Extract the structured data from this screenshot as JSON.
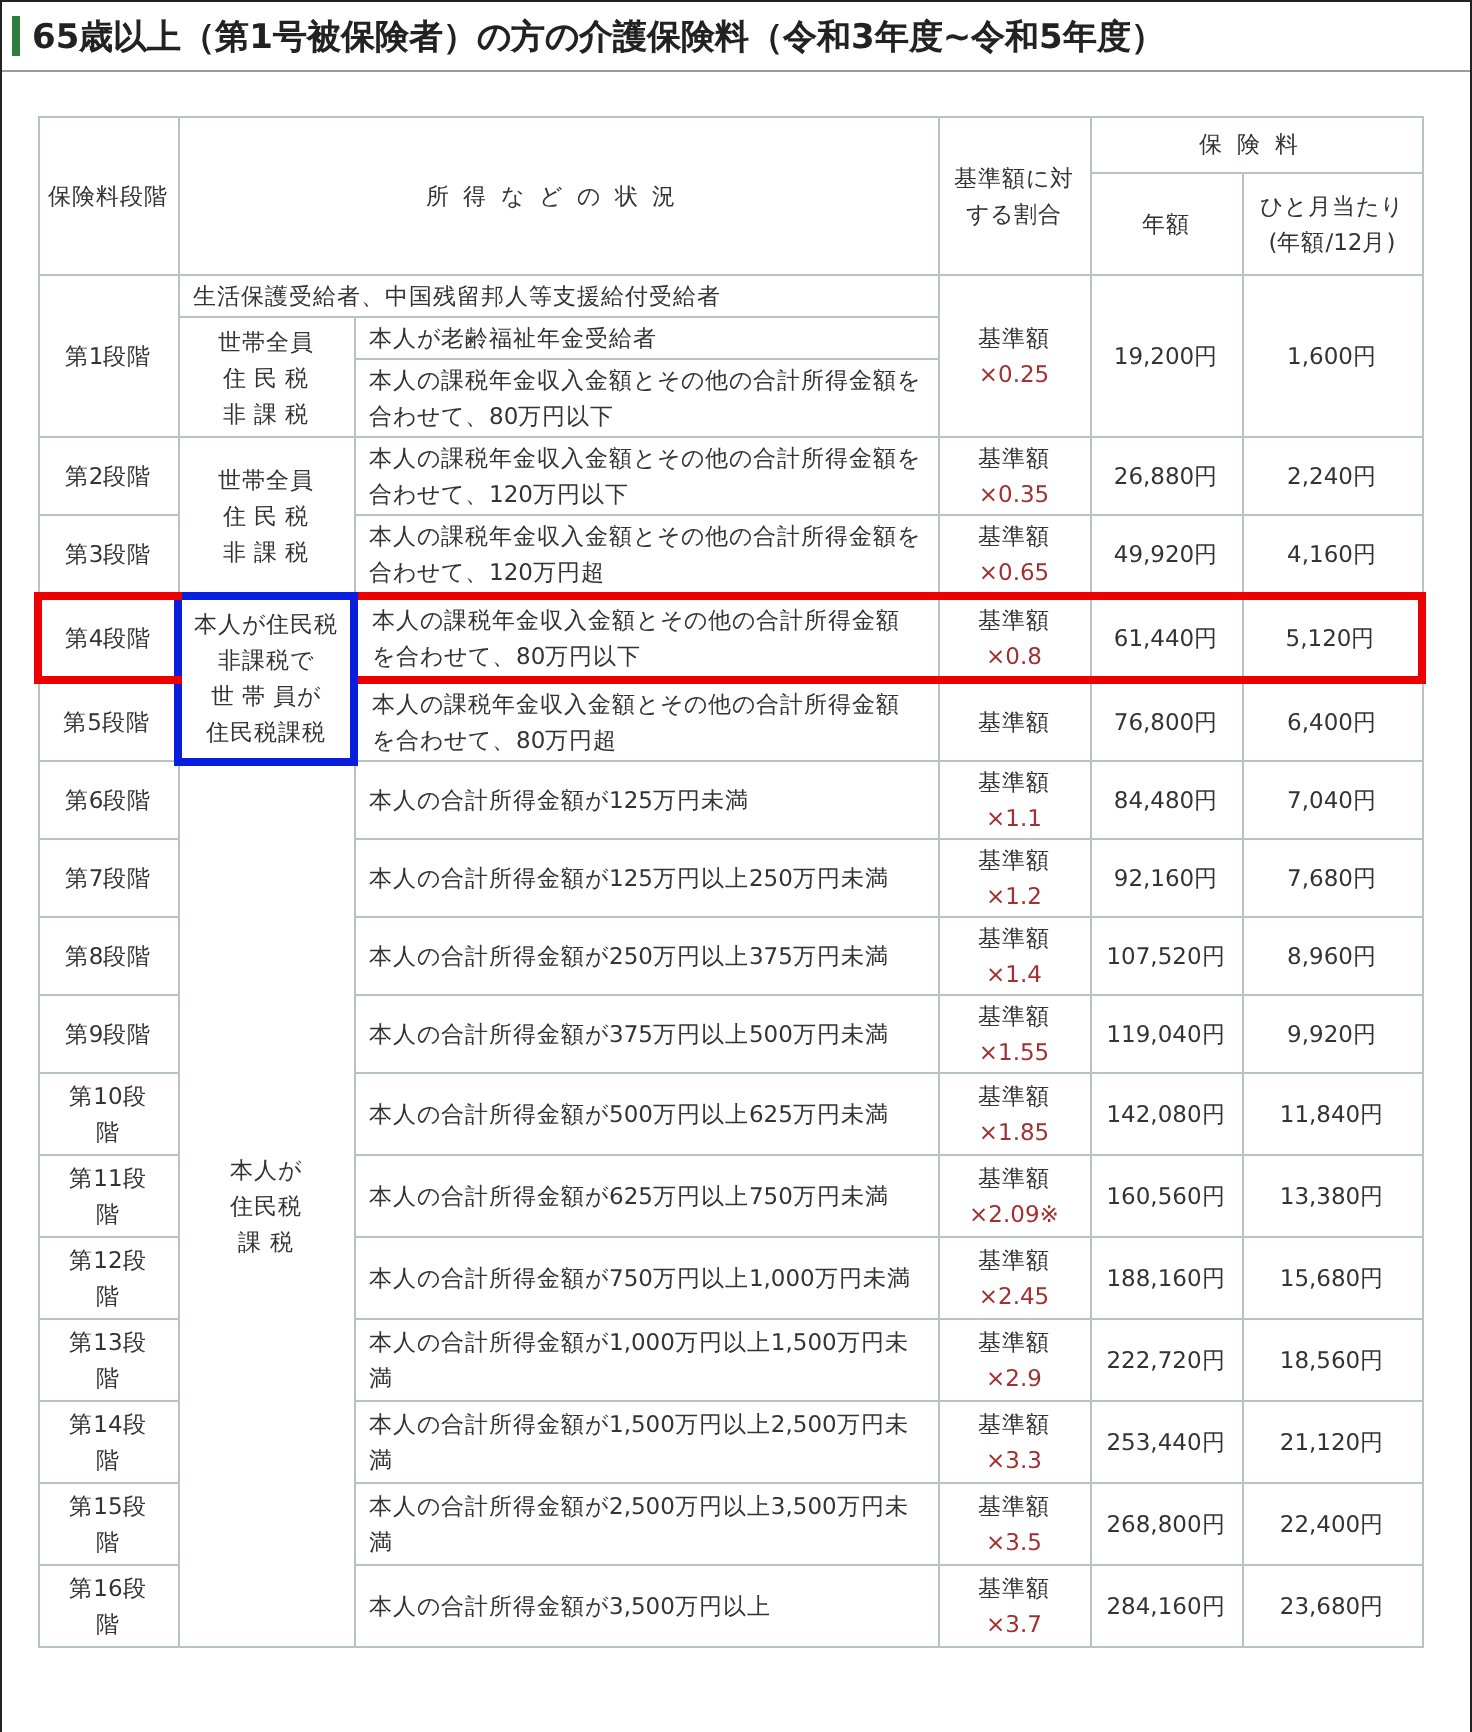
{
  "title": "65歳以上（第1号被保険者）の方の介護保険料（令和3年度~令和5年度）",
  "table": {
    "headers": {
      "stage": "保険料段階",
      "situation": "所得などの状況",
      "ratio": "基準額に対する割合",
      "premium": "保険料",
      "annual": "年額",
      "monthly": "ひと月当たり(年額/12月)"
    },
    "groups": [
      {
        "lines": [
          "世帯全員",
          "住 民 税",
          "非 課 税"
        ],
        "highlighted": false,
        "stages": [
          {
            "label": "第1段階",
            "highlighted": false,
            "general_condition": "生活保護受給者、中国残留邦人等支援給付受給者",
            "conditions": [
              "本人が老齢福祉年金受給者",
              "本人の課税年金収入金額とその他の合計所得金額を合わせて、80万円以下"
            ],
            "ratio": "基準額",
            "multiplier": "×0.25",
            "annual": "19,200円",
            "monthly": "1,600円"
          }
        ]
      },
      {
        "lines": [
          "世帯全員",
          "住 民 税",
          "非 課 税"
        ],
        "highlighted": false,
        "stages": [
          {
            "label": "第2段階",
            "highlighted": false,
            "conditions": [
              "本人の課税年金収入金額とその他の合計所得金額を合わせて、120万円以下"
            ],
            "ratio": "基準額",
            "multiplier": "×0.35",
            "annual": "26,880円",
            "monthly": "2,240円"
          },
          {
            "label": "第3段階",
            "highlighted": false,
            "conditions": [
              "本人の課税年金収入金額とその他の合計所得金額を合わせて、120万円超"
            ],
            "ratio": "基準額",
            "multiplier": "×0.65",
            "annual": "49,920円",
            "monthly": "4,160円"
          }
        ]
      },
      {
        "lines": [
          "本人が住民税",
          "非課税で",
          "世 帯 員が",
          "住民税課税"
        ],
        "highlighted": true,
        "stages": [
          {
            "label": "第4段階",
            "highlighted": true,
            "conditions": [
              "本人の課税年金収入金額とその他の合計所得金額を合わせて、80万円以下"
            ],
            "ratio": "基準額",
            "multiplier": "×0.8",
            "annual": "61,440円",
            "monthly": "5,120円"
          },
          {
            "label": "第5段階",
            "highlighted": false,
            "conditions": [
              "本人の課税年金収入金額とその他の合計所得金額を合わせて、80万円超"
            ],
            "ratio": "基準額",
            "annual": "76,800円",
            "monthly": "6,400円"
          }
        ]
      },
      {
        "lines": [
          "本人が",
          "住民税",
          "課 税"
        ],
        "highlighted": false,
        "stages": [
          {
            "label": "第6段階",
            "highlighted": false,
            "conditions": [
              "本人の合計所得金額が125万円未満"
            ],
            "ratio": "基準額",
            "multiplier": "×1.1",
            "annual": "84,480円",
            "monthly": "7,040円"
          },
          {
            "label": "第7段階",
            "highlighted": false,
            "conditions": [
              "本人の合計所得金額が125万円以上250万円未満"
            ],
            "ratio": "基準額",
            "multiplier": "×1.2",
            "annual": "92,160円",
            "monthly": "7,680円"
          },
          {
            "label": "第8段階",
            "highlighted": false,
            "conditions": [
              "本人の合計所得金額が250万円以上375万円未満"
            ],
            "ratio": "基準額",
            "multiplier": "×1.4",
            "annual": "107,520円",
            "monthly": "8,960円"
          },
          {
            "label": "第9段階",
            "highlighted": false,
            "conditions": [
              "本人の合計所得金額が375万円以上500万円未満"
            ],
            "ratio": "基準額",
            "multiplier": "×1.55",
            "annual": "119,040円",
            "monthly": "9,920円"
          },
          {
            "label": "第10段階",
            "highlighted": false,
            "conditions": [
              "本人の合計所得金額が500万円以上625万円未満"
            ],
            "ratio": "基準額",
            "multiplier": "×1.85",
            "annual": "142,080円",
            "monthly": "11,840円"
          },
          {
            "label": "第11段階",
            "highlighted": false,
            "conditions": [
              "本人の合計所得金額が625万円以上750万円未満"
            ],
            "ratio": "基準額",
            "multiplier": "×2.09※",
            "annual": "160,560円",
            "monthly": "13,380円"
          },
          {
            "label": "第12段階",
            "highlighted": false,
            "conditions": [
              "本人の合計所得金額が750万円以上1,000万円未満"
            ],
            "ratio": "基準額",
            "multiplier": "×2.45",
            "annual": "188,160円",
            "monthly": "15,680円"
          },
          {
            "label": "第13段階",
            "highlighted": false,
            "conditions": [
              "本人の合計所得金額が1,000万円以上1,500万円未満"
            ],
            "ratio": "基準額",
            "multiplier": "×2.9",
            "annual": "222,720円",
            "monthly": "18,560円"
          },
          {
            "label": "第14段階",
            "highlighted": false,
            "conditions": [
              "本人の合計所得金額が1,500万円以上2,500万円未満"
            ],
            "ratio": "基準額",
            "multiplier": "×3.3",
            "annual": "253,440円",
            "monthly": "21,120円"
          },
          {
            "label": "第15段階",
            "highlighted": false,
            "conditions": [
              "本人の合計所得金額が2,500万円以上3,500万円未満"
            ],
            "ratio": "基準額",
            "multiplier": "×3.5",
            "annual": "268,800円",
            "monthly": "22,400円"
          },
          {
            "label": "第16段階",
            "highlighted": false,
            "conditions": [
              "本人の合計所得金額が3,500万円以上"
            ],
            "ratio": "基準額",
            "multiplier": "×3.7",
            "annual": "284,160円",
            "monthly": "23,680円"
          }
        ]
      }
    ]
  }
}
